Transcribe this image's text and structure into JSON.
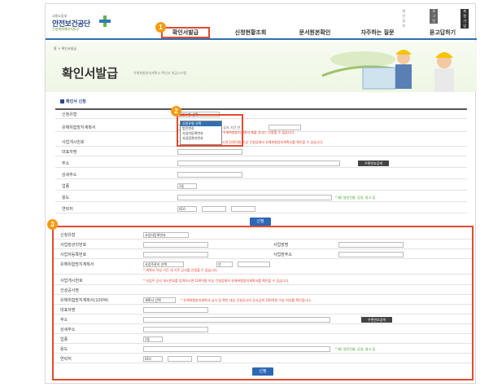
{
  "header": {
    "logo_small": "고용노동부",
    "logo_main": "안전보건공단",
    "logo_sub": "건설재해예방지원부",
    "util_links": [
      "개인정보",
      "로그인",
      "회원가입"
    ],
    "nav": [
      "확인서발급",
      "신청현황조회",
      "문서원본확인",
      "자주하는 질문",
      "묻고답하기"
    ]
  },
  "visual": {
    "breadcrumb": "홈 > 확인서발급",
    "title": "확인서발급",
    "description": "유해위험방지계획서 확인서 발급시스템"
  },
  "section_title": "확인서 신청",
  "badges": [
    "1",
    "2",
    "3"
  ],
  "form1": {
    "rows": [
      {
        "label": "신청유형"
      },
      {
        "label": "유해위험방지계획서",
        "date_note": "사업시 공사 기간 년",
        "warn": "* 기존 유해위험방지계획서 제출 공사는 신청할 수 없습니다."
      },
      {
        "label": "사업개시번호",
        "note": "* 사업주 공사 개시번호를 입력하시면 100억원 이상 건설업체의 유해위험방지계획서를 확인할 수 있습니다."
      },
      {
        "label": "대표자명"
      },
      {
        "label": "주소",
        "button": "우편번호검색"
      },
      {
        "label": "상세주소"
      },
      {
        "label": "업종",
        "select": "1동"
      },
      {
        "label": "용도",
        "hint": "* 예) 일반건물, 공장, 창고 등"
      },
      {
        "label": "연락처",
        "select": "010"
      }
    ],
    "dropdown": {
      "value": "신청유형 선택",
      "options": [
        "신청유형 선택",
        "법인번호",
        "사업자등록번호",
        "사업장관리번호"
      ]
    },
    "submit": "신청"
  },
  "form2": {
    "rows": [
      {
        "label": "신청유형",
        "select": "사업자등록번호"
      },
      {
        "label": "사업장관리번호",
        "right_label": "사업장명"
      },
      {
        "label": "사업자등록번호",
        "right_label": "사업장주소"
      },
      {
        "label": "유해위험방지계획서",
        "select": "사업주관리 선택",
        "select2": "년",
        "warn": "* 계획서 작성 기간 내 기존 공사를 신청할 수 없습니다."
      },
      {
        "label": "사업개시번호",
        "note": "* 사업주 공사 개시번호를 입력하시면 100억원 이상 건설업체의 유해위험방지계획서를 확인할 수 있습니다."
      },
      {
        "label": "건설공사명"
      },
      {
        "label": "유해위험방지계획서(100억)",
        "select": "계획서 선택",
        "note": "* 유해위험방지계획서 심사 및 확인 대상 건설공사의 공사금액 100억원 이상 여부를 확인합니다."
      },
      {
        "label": "대표자명"
      },
      {
        "label": "주소",
        "button": "우편번호검색"
      },
      {
        "label": "상세주소"
      },
      {
        "label": "업종",
        "select": "1동"
      },
      {
        "label": "용도",
        "hint": "* 예) 일반건물, 공장, 창고 등"
      },
      {
        "label": "연락처",
        "select": "010"
      }
    ],
    "submit": "신청"
  }
}
